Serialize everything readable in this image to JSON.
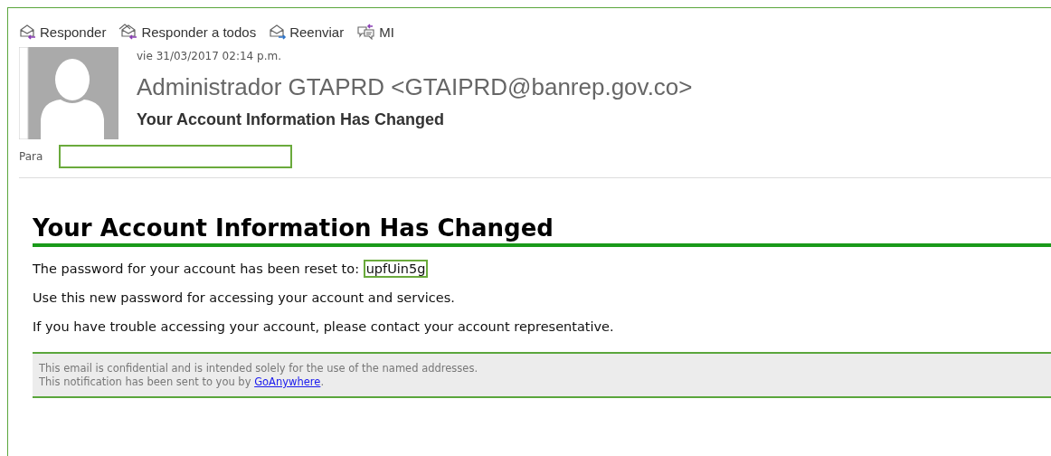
{
  "toolbar": [
    {
      "label": "Responder",
      "kind": "reply"
    },
    {
      "label": "Responder a todos",
      "kind": "reply_all"
    },
    {
      "label": "Reenviar",
      "kind": "forward"
    },
    {
      "label": "MI",
      "kind": "im"
    }
  ],
  "header": {
    "date": "vie 31/03/2017 02:14 p.m.",
    "sender": "Administrador GTAPRD <GTAIPRD@banrep.gov.co>",
    "subject": "Your Account Information Has Changed",
    "to_label": "Para"
  },
  "body": {
    "heading": "Your Account Information Has Changed",
    "password_intro": "The password for your account has been reset to:",
    "password": "upfUin5g",
    "paragraphs": [
      "Use this new password for accessing your account and services.",
      "If you have trouble accessing your account, please contact your account representative."
    ],
    "footer": {
      "line_1": "This email is confidential and is intended solely for the use of the named addresses.",
      "line_2": "This notification has been sent to you by",
      "link": "GoAnywhere",
      "line_2_end": "."
    }
  }
}
